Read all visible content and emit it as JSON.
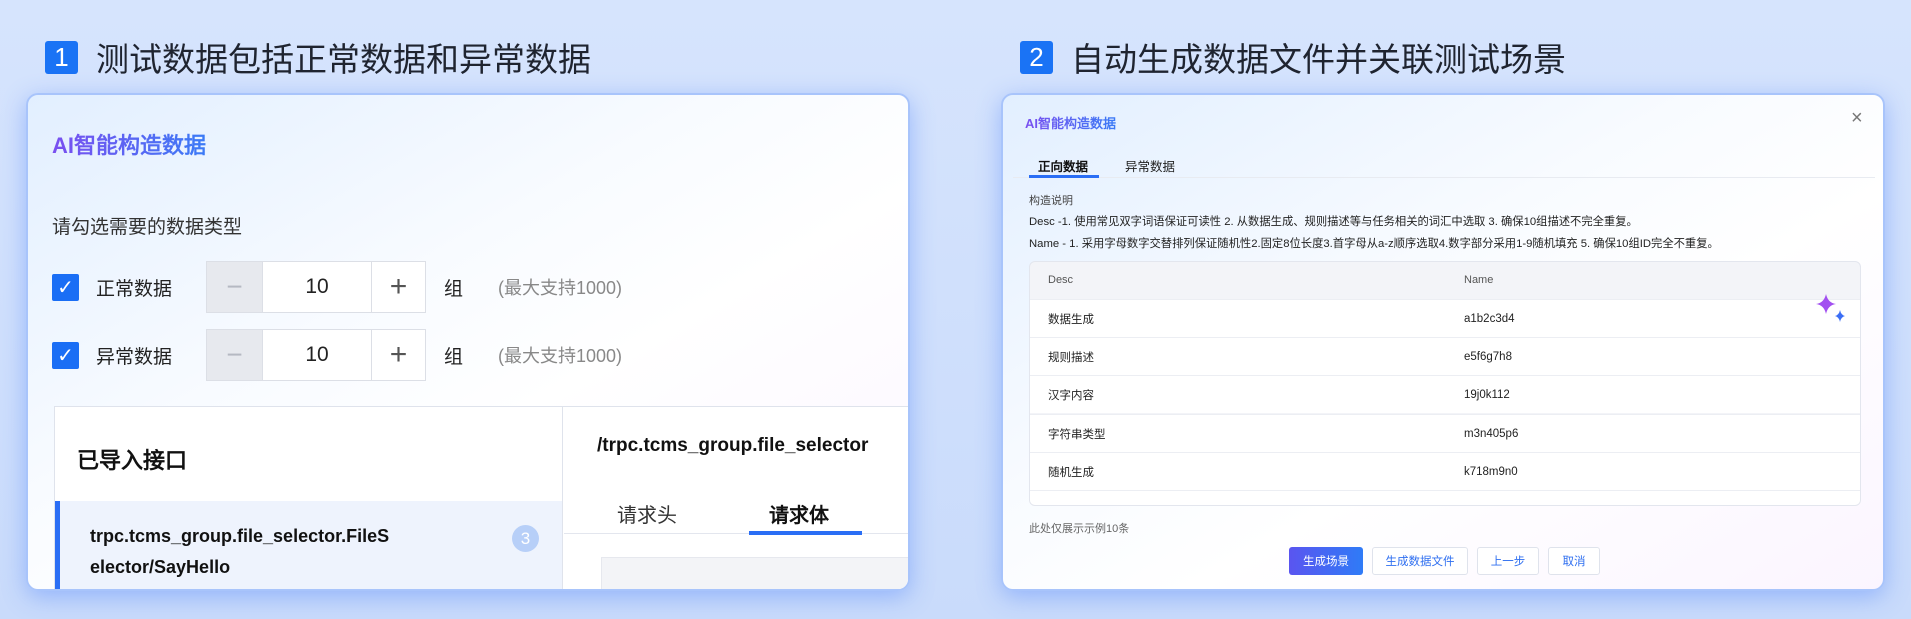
{
  "left": {
    "step_number": "1",
    "step_title": "测试数据包括正常数据和异常数据",
    "dialog_title": "AI智能构造数据",
    "prompt": "请勾选需要的数据类型",
    "rows": [
      {
        "label": "正常数据",
        "checked": true,
        "value": "10",
        "unit": "组",
        "hint": "(最大支持1000)"
      },
      {
        "label": "异常数据",
        "checked": true,
        "value": "10",
        "unit": "组",
        "hint": "(最大支持1000)"
      }
    ],
    "imported_title": "已导入接口",
    "interface_line1": "trpc.tcms_group.file_selector.FileS",
    "interface_line2": "elector/SayHello",
    "interface_badge": "3",
    "path": "/trpc.tcms_group.file_selector",
    "tabs": [
      "请求头",
      "请求体"
    ],
    "active_tab": "请求体"
  },
  "right": {
    "step_number": "2",
    "step_title": "自动生成数据文件并关联测试场景",
    "dialog_title": "AI智能构造数据",
    "close": "×",
    "tabs": [
      "正向数据",
      "异常数据"
    ],
    "section_label": "构造说明",
    "desc_rule": "Desc -1. 使用常见双字词语保证可读性 2. 从数据生成、规则描述等与任务相关的词汇中选取 3. 确保10组描述不完全重复。",
    "name_rule": "Name - 1. 采用字母数字交替排列保证随机性2.固定8位长度3.首字母从a-z顺序选取4.数字部分采用1-9随机填充 5. 确保10组ID完全不重复。",
    "columns": [
      "Desc",
      "Name"
    ],
    "rows": [
      {
        "desc": "数据生成",
        "name": "a1b2c3d4"
      },
      {
        "desc": "规则描述",
        "name": "e5f6g7h8"
      },
      {
        "desc": "汉字内容",
        "name": "19j0k112"
      },
      {
        "desc": "字符串类型",
        "name": "m3n405p6"
      },
      {
        "desc": "随机生成",
        "name": "k718m9n0"
      }
    ],
    "note": "此处仅展示示例10条",
    "buttons": [
      "生成场景",
      "生成数据文件",
      "上一步",
      "取消"
    ]
  }
}
